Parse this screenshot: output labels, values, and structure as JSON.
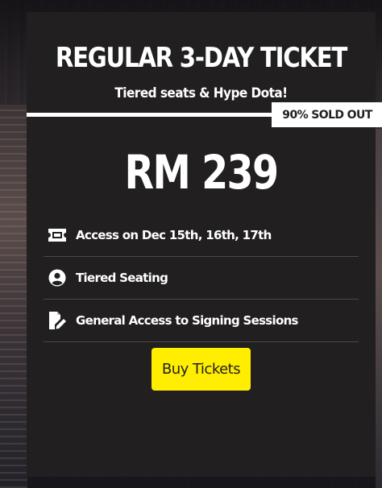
{
  "ticket": {
    "title": "REGULAR 3-DAY TICKET",
    "subtitle": "Tiered seats & Hype Dota!",
    "sold_badge": "90% SOLD OUT",
    "price": "RM 239",
    "features": [
      {
        "icon": "ticket-icon",
        "label": "Access on Dec 15th, 16th, 17th"
      },
      {
        "icon": "user-circle-icon",
        "label": "Tiered Seating"
      },
      {
        "icon": "signature-icon",
        "label": "General Access to Signing Sessions"
      }
    ],
    "buy_button": "Buy Tickets"
  },
  "colors": {
    "card_background": "#211f1f",
    "accent_yellow": "#ffee00",
    "text": "#ffffff",
    "divider": "#4a4848"
  }
}
